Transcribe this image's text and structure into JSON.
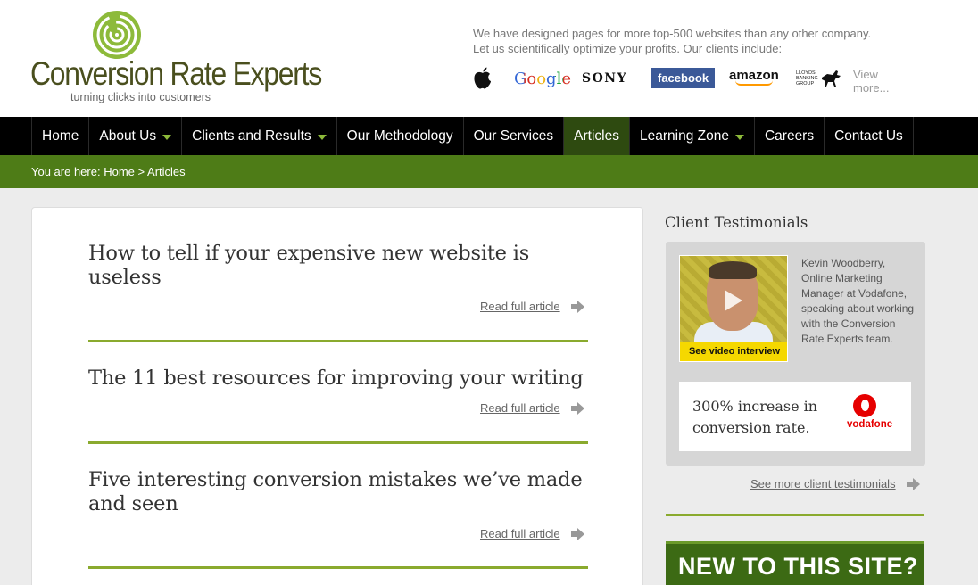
{
  "header": {
    "logo_title": "Conversion Rate Experts",
    "logo_tagline": "turning clicks into customers",
    "intro_line1": "We have designed pages for more top-500 websites than any other company.",
    "intro_line2": "Let us scientifically optimize your profits. Our clients include:",
    "clients": {
      "google": "Google",
      "sony": "SONY",
      "facebook": "facebook",
      "amazon": "amazon",
      "lloyds_1": "LLOYDS",
      "lloyds_2": "BANKING",
      "lloyds_3": "GROUP"
    },
    "view_more": "View more...",
    "colors": {
      "brand_green": "#8dba3a",
      "logo_text": "#4a4f1e"
    }
  },
  "nav": {
    "items": [
      {
        "label": "Home",
        "dropdown": false
      },
      {
        "label": "About Us",
        "dropdown": true
      },
      {
        "label": "Clients and Results",
        "dropdown": true
      },
      {
        "label": "Our Methodology",
        "dropdown": false
      },
      {
        "label": "Our Services",
        "dropdown": false
      },
      {
        "label": "Articles",
        "dropdown": false,
        "active": true
      },
      {
        "label": "Learning Zone",
        "dropdown": true
      },
      {
        "label": "Careers",
        "dropdown": false
      },
      {
        "label": "Contact Us",
        "dropdown": false
      }
    ]
  },
  "breadcrumb": {
    "prefix": "You are here:",
    "home": "Home",
    "separator": ">",
    "current": "Articles"
  },
  "articles": [
    {
      "title": "How to tell if your expensive new website is useless",
      "link": "Read full article"
    },
    {
      "title": "The 11 best resources for improving your writing",
      "link": "Read full article"
    },
    {
      "title": "Five interesting conversion mistakes we’ve made and seen",
      "link": "Read full article"
    }
  ],
  "sidebar": {
    "title": "Client Testimonials",
    "video_button": "See video interview",
    "testimonial_text": "Kevin Woodberry, Online Marketing Manager at Vodafone, speaking about working with the Conversion Rate Experts team.",
    "stat": "300% increase in conversion rate.",
    "stat_brand": "vodafone",
    "see_more": "See more client testimonials",
    "banner": "NEW TO THIS SITE?"
  }
}
